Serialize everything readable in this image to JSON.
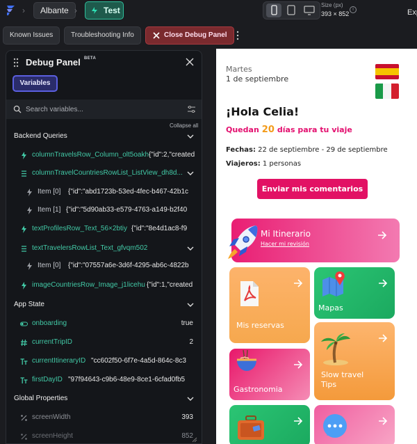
{
  "topbar": {
    "project_name": "Albante",
    "run_mode_label": "Test",
    "size_label": "Size (px)",
    "size_value": "393 × 852",
    "info_glyph": "i",
    "cut_label": "Exp"
  },
  "toolbar": {
    "known_issues": "Known Issues",
    "troubleshooting": "Troubleshooting Info",
    "close_debug": "Close Debug Panel"
  },
  "debug_panel": {
    "title": "Debug Panel",
    "badge": "BETA",
    "tab_variables": "Variables",
    "search_placeholder": "Search variables...",
    "collapse_all": "Collapse all",
    "sections": {
      "backend": "Backend Queries",
      "app_state": "App State",
      "global": "Global Properties"
    },
    "backend_rows": [
      {
        "key": "columnTravelsRow_Column_olt5oakh",
        "value": "{\"id\":2,\"created"
      },
      {
        "key": "columnTravelCountriesRowList_ListView_dh8d...",
        "value": ""
      },
      {
        "key": "Item [0]",
        "value": "{\"id\":\"abd1723b-53ed-4fec-b467-42b1c"
      },
      {
        "key": "Item [1]",
        "value": "{\"id\":\"5d90ab33-e579-4763-a149-b2f40"
      },
      {
        "key": "textProfilesRow_Text_56×2btiy",
        "value": "{\"id\":\"8e4d1ac8-f9"
      },
      {
        "key": "textTravelersRowList_Text_gfvqm502",
        "value": ""
      },
      {
        "key": "Item [0]",
        "value": "{\"id\":\"07557a6e-3d6f-4295-ab6c-4822b"
      },
      {
        "key": "imageCountriesRow_Image_j1licehu",
        "value": "{\"id\":1,\"created"
      }
    ],
    "app_state_rows": [
      {
        "key": "onboarding",
        "value": "true"
      },
      {
        "key": "currentTripID",
        "value": "2"
      },
      {
        "key": "currentItineraryID",
        "value": "\"cc602f50-6f7e-4a5d-864c-8c3"
      },
      {
        "key": "firstDayID",
        "value": "\"97f94643-c9b6-48e9-8ce1-6cfad0fb5"
      }
    ],
    "global_rows": [
      {
        "key": "screenWidth",
        "value": "393"
      },
      {
        "key": "screenHeight",
        "value": "852"
      }
    ]
  },
  "app_preview": {
    "day": "Martes",
    "date": "1 de septiembre",
    "greeting": "¡Hola Celia!",
    "countdown_prefix": "Quedan",
    "countdown_days": "20",
    "countdown_suffix": "días para tu viaje",
    "dates_label": "Fechas:",
    "dates_value": "22 de septiembre - 29 de septiembre",
    "travelers_label": "Viajeros:",
    "travelers_value": "1 personas",
    "feedback_button": "Enviar mis comentarios",
    "cards": {
      "itinerary_title": "Mi Itinerario",
      "itinerary_link": "Hacer mi revisión",
      "reservations": "Mis reservas",
      "maps": "Mapas",
      "slow_travel": "Slow travel Tips",
      "gastronomy": "Gastronomia"
    }
  },
  "colors": {
    "accent_teal": "#2fbf9c",
    "close_red": "#a8393f",
    "variables_tab": "#5b5fe0",
    "brand_pink": "#e21164",
    "countdown_orange": "#f39b1a"
  },
  "icons": [
    "logo-icon",
    "play-icon",
    "phone-icon",
    "tablet-icon",
    "desktop-icon",
    "info-icon",
    "close-icon",
    "kebab-icon",
    "drag-handle-icon",
    "search-icon",
    "filter-icon",
    "chevron-down-icon",
    "lightning-icon",
    "list-icon",
    "toggle-icon",
    "hash-icon",
    "text-type-icon",
    "percent-icon",
    "arrow-right-icon",
    "rocket-icon",
    "pdf-icon",
    "map-pin-icon",
    "palm-tree-icon",
    "noodle-bowl-icon",
    "suitcase-icon",
    "chat-bubble-icon"
  ]
}
